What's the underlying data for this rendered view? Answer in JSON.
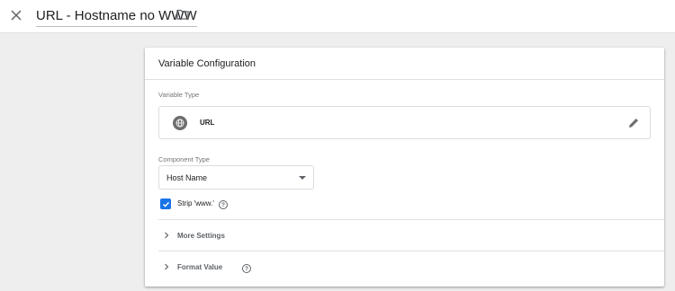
{
  "header": {
    "close_icon": "close-icon",
    "title": "URL - Hostname no WWW",
    "folder_icon": "folder-icon"
  },
  "card": {
    "title": "Variable Configuration",
    "variable_type": {
      "label": "Variable Type",
      "icon": "globe-icon",
      "value": "URL",
      "edit_icon": "pencil-icon"
    },
    "component_type": {
      "label": "Component Type",
      "selected": "Host Name"
    },
    "strip_www": {
      "label": "Strip 'www.'",
      "checked": true,
      "help": "?"
    },
    "sections": [
      {
        "label": "More Settings",
        "expanded": false
      },
      {
        "label": "Format Value",
        "expanded": false,
        "help": "?"
      }
    ]
  },
  "colors": {
    "accent": "#1a73e8",
    "background": "#eeeeee",
    "card": "#ffffff"
  }
}
